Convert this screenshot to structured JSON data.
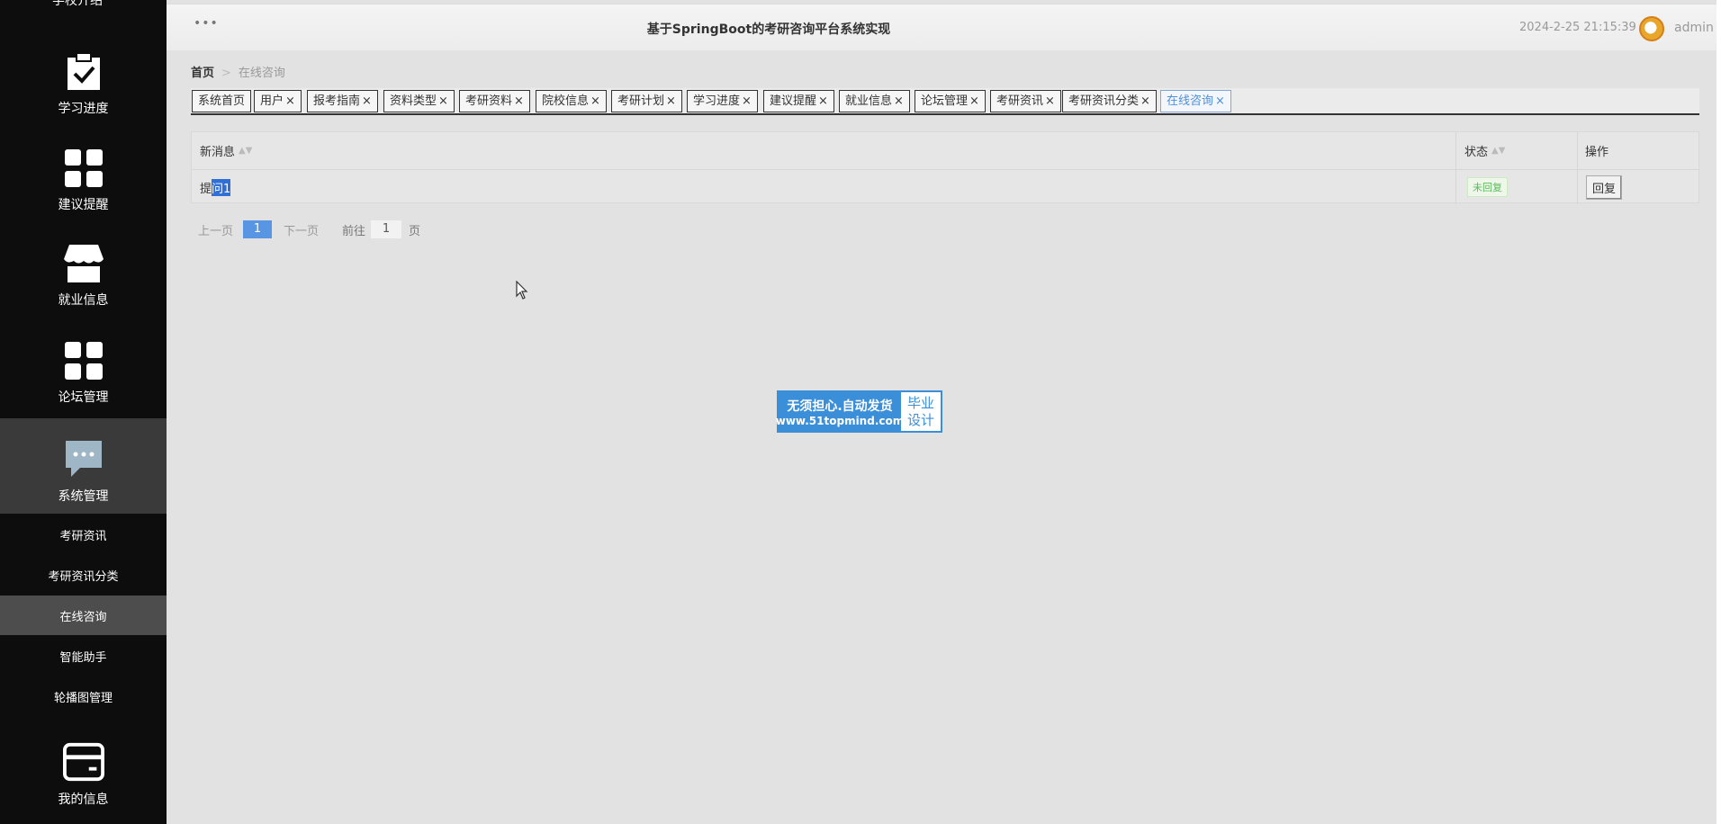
{
  "topbar": {
    "menu_dots": "•••",
    "title": "基于SpringBoot的考研咨询平台系统实现",
    "datetime": "2024-2-25 21:15:39",
    "username": "admin"
  },
  "sidebar": {
    "cut_top_label": "学校介绍",
    "items": [
      {
        "label": "学习进度",
        "icon": "clipboard-check-icon"
      },
      {
        "label": "建议提醒",
        "icon": "grid-icon"
      },
      {
        "label": "就业信息",
        "icon": "store-icon"
      },
      {
        "label": "论坛管理",
        "icon": "grid-icon"
      },
      {
        "label": "系统管理",
        "icon": "chat-icon"
      },
      {
        "label": "我的信息",
        "icon": "card-icon"
      }
    ],
    "subitems": [
      "考研资讯",
      "考研资讯分类",
      "在线咨询",
      "智能助手",
      "轮播图管理"
    ]
  },
  "breadcrumb": {
    "home": "首页",
    "separator": ">",
    "current": "在线咨询"
  },
  "tabs": [
    {
      "label": "系统首页",
      "closable": false
    },
    {
      "label": "用户",
      "closable": true
    },
    {
      "label": "报考指南",
      "closable": true
    },
    {
      "label": "资料类型",
      "closable": true
    },
    {
      "label": "考研资料",
      "closable": true
    },
    {
      "label": "院校信息",
      "closable": true
    },
    {
      "label": "考研计划",
      "closable": true
    },
    {
      "label": "学习进度",
      "closable": true
    },
    {
      "label": "建议提醒",
      "closable": true
    },
    {
      "label": "就业信息",
      "closable": true
    },
    {
      "label": "论坛管理",
      "closable": true
    },
    {
      "label": "考研资讯",
      "closable": true
    },
    {
      "label": "考研资讯分类",
      "closable": true
    },
    {
      "label": "在线咨询",
      "closable": true,
      "active": true
    }
  ],
  "tab_close_glyph": "×",
  "table": {
    "columns": [
      "新消息",
      "状态",
      "操作"
    ],
    "sort_glyph": "▲▼",
    "row": {
      "message_prefix": "提",
      "message_selected": "问1",
      "status": "未回复",
      "action": "回复"
    }
  },
  "pagination": {
    "prev": "上一页",
    "page": "1",
    "next": "下一页",
    "goto_label": "前往",
    "goto_value": "1",
    "page_unit": "页"
  },
  "watermark": {
    "line1": "无须担心.自动发货",
    "line2": "www.51topmind.com",
    "right1": "毕业",
    "right2": "设计"
  },
  "colors": {
    "sidebar_bg": "#0d0d0d",
    "accent": "#5895e3",
    "status_green": "#5cb85c"
  }
}
